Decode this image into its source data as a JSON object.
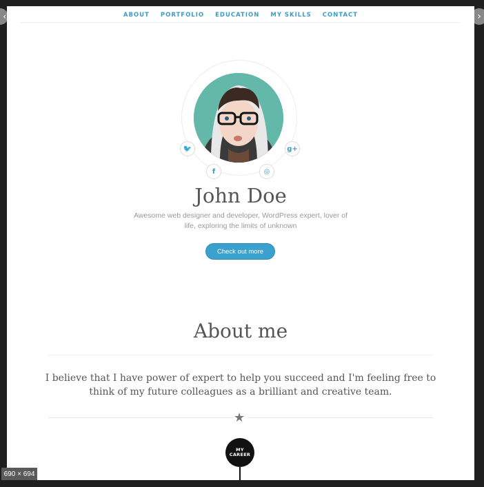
{
  "nav": {
    "items": [
      "ABOUT",
      "PORTFOLIO",
      "EDUCATION",
      "MY SKILLS",
      "CONTACT"
    ]
  },
  "profile": {
    "name": "John Doe",
    "bio": "Awesome web designer and developer, WordPress expert, lover of life, exploring the limits of unknown",
    "cta_label": "Check out more",
    "social_icons": [
      "twitter-icon",
      "google-plus-icon",
      "facebook-icon",
      "dribbble-icon"
    ],
    "social_glyphs": {
      "twitter": "🐦",
      "google": "g+",
      "facebook": "f",
      "dribbble": "◎"
    }
  },
  "about": {
    "title": "About me",
    "text": "I believe that I have power of expert to help you succeed and I'm feeling free to think of my future colleagues as a brilliant and creative team."
  },
  "career": {
    "line1": "MY",
    "line2": "CAREER"
  },
  "viewer": {
    "dimensions": "690 × 694"
  },
  "colors": {
    "accent": "#3aa1cf",
    "avatar_bg": "#63b8a9",
    "dark": "#111111"
  }
}
